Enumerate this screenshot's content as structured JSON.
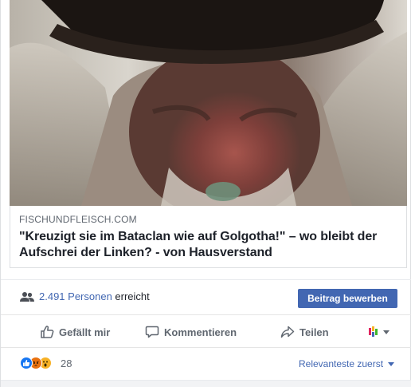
{
  "post": {
    "link": {
      "domain": "FISCHUNDFLEISCH.COM",
      "headline": "\"Kreuzigt sie im Bataclan wie auf Golgotha!\" – wo bleibt der Aufschrei der Linken? - von Hausverstand"
    },
    "reach": {
      "count_label": "2.491 Personen",
      "suffix": " erreicht",
      "promote_button": "Beitrag bewerben"
    },
    "actions": {
      "like": "Gefällt mir",
      "comment": "Kommentieren",
      "share": "Teilen"
    },
    "reactions": {
      "count": "28",
      "types": [
        "like",
        "angry",
        "wow"
      ]
    },
    "comments": {
      "sort_label": "Relevanteste zuerst"
    }
  },
  "colors": {
    "brand_blue": "#4267b2",
    "text_primary": "#1d2129",
    "text_secondary": "#606770",
    "like_blue": "#1877f2",
    "angry_orange": "#e9710f",
    "wow_yellow": "#f7b125"
  }
}
